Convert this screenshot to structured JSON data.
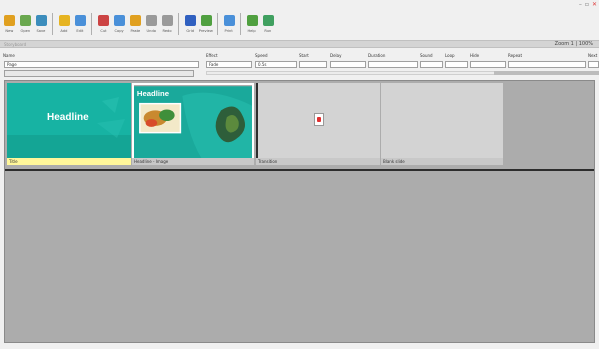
{
  "window": {
    "title": "",
    "controls": [
      "minimize",
      "restore",
      "close"
    ]
  },
  "toolbar": {
    "groups": [
      [
        {
          "label": "New",
          "icon": "new-file-icon",
          "color": "#e0a020"
        },
        {
          "label": "Open",
          "icon": "open-folder-icon",
          "color": "#6aa84f"
        },
        {
          "label": "Save",
          "icon": "save-icon",
          "color": "#3c8dbc"
        }
      ],
      [
        {
          "label": "Add",
          "icon": "add-slide-icon",
          "color": "#e6b422"
        },
        {
          "label": "Edit",
          "icon": "edit-icon",
          "color": "#4a90d9"
        }
      ],
      [
        {
          "label": "Cut",
          "icon": "cut-icon",
          "color": "#cc4444"
        },
        {
          "label": "Copy",
          "icon": "copy-icon",
          "color": "#4a90d9"
        },
        {
          "label": "Paste",
          "icon": "paste-icon",
          "color": "#e0a020"
        },
        {
          "label": "Undo",
          "icon": "undo-icon",
          "color": "#9a9a9a"
        },
        {
          "label": "Redo",
          "icon": "redo-icon",
          "color": "#9a9a9a"
        }
      ],
      [
        {
          "label": "Grid",
          "icon": "grid-icon",
          "color": "#3060c0"
        },
        {
          "label": "Preview",
          "icon": "preview-icon",
          "color": "#50a040"
        }
      ],
      [
        {
          "label": "Print",
          "icon": "print-icon",
          "color": "#4a90d9"
        }
      ],
      [
        {
          "label": "Help",
          "icon": "help-icon",
          "color": "#50a040"
        },
        {
          "label": "Run",
          "icon": "run-icon",
          "color": "#40a060"
        }
      ]
    ]
  },
  "strip": {
    "left_text": "Storyboard",
    "right_text": "Zoom 1 | 100%"
  },
  "properties": {
    "headers": [
      "Name",
      "Effect",
      "Speed",
      "Start",
      "Delay",
      "Duration",
      "Sound",
      "Loop",
      "Hide",
      "Repeat",
      "Next"
    ],
    "name_value": "Page",
    "effect_value": "Fade",
    "speed_value": "0.5s"
  },
  "slides": [
    {
      "title": "Headline",
      "caption": "Title",
      "kind": "teal",
      "selected": false
    },
    {
      "title": "Headline",
      "caption": "Headline - Image",
      "kind": "image",
      "selected": true
    },
    {
      "title": "",
      "caption": "Transition",
      "kind": "blank-icon",
      "selected": false
    },
    {
      "title": "",
      "caption": "Blank slide",
      "kind": "blank",
      "selected": false
    }
  ]
}
